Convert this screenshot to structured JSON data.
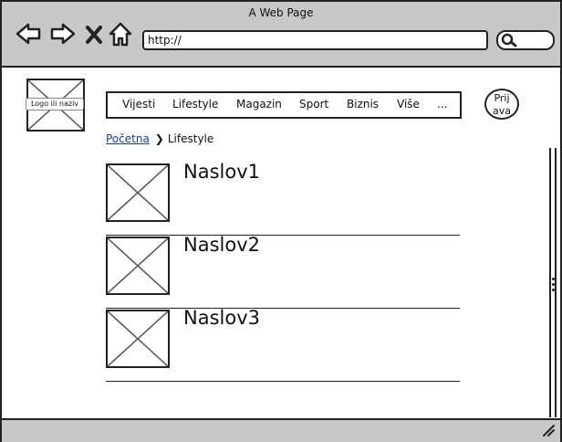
{
  "window": {
    "title": "A Web Page"
  },
  "browser": {
    "url": "http://"
  },
  "logo": {
    "label": "Logo ili naziv"
  },
  "nav": {
    "items": [
      {
        "label": "Vijesti"
      },
      {
        "label": "Lifestyle"
      },
      {
        "label": "Magazin"
      },
      {
        "label": "Sport"
      },
      {
        "label": "Biznis"
      },
      {
        "label": "Više"
      },
      {
        "label": "..."
      }
    ]
  },
  "login": {
    "line1": "Prij",
    "line2": "ava"
  },
  "breadcrumb": {
    "home": "Početna",
    "current": "Lifestyle"
  },
  "articles": [
    {
      "title": "Naslov1"
    },
    {
      "title": "Naslov2"
    },
    {
      "title": "Naslov3"
    }
  ]
}
